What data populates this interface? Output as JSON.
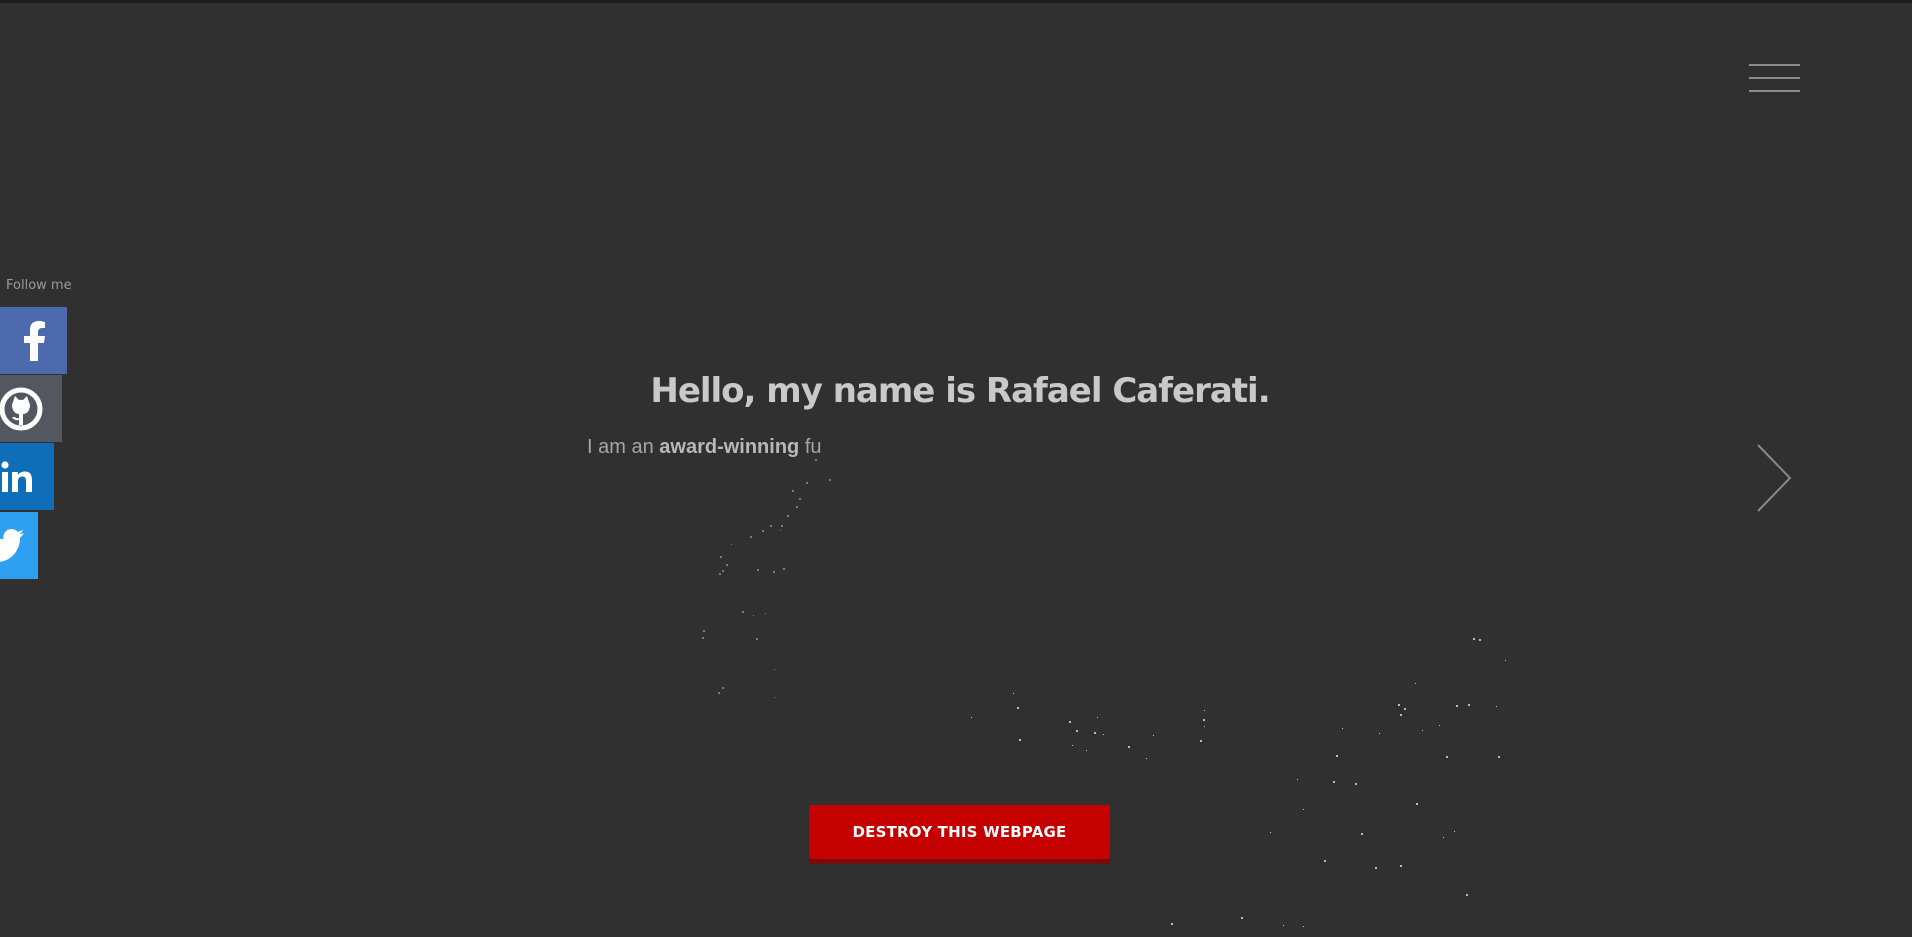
{
  "header": {
    "menu_icon": "hamburger-menu-icon"
  },
  "sidebar": {
    "label": "Follow me",
    "items": [
      {
        "icon": "facebook-icon",
        "color": "#4e6aae"
      },
      {
        "icon": "github-icon",
        "color": "#525760"
      },
      {
        "icon": "linkedin-icon",
        "color": "#0e6eb7"
      },
      {
        "icon": "twitter-icon",
        "color": "#2f9ff2"
      }
    ]
  },
  "hero": {
    "title": "Hello, my name is Rafael Caferati.",
    "tagline_prefix": "I am an ",
    "tagline_emphasis": "award-winning",
    "tagline_suffix": " fu",
    "next_icon": "chevron-right-icon",
    "cta_label": "DESTROY THIS WEBPAGE"
  },
  "colors": {
    "background": "#303030",
    "cta": "#c50000",
    "cta_shadow": "#7a0b0b",
    "title": "#c9c9c9"
  }
}
